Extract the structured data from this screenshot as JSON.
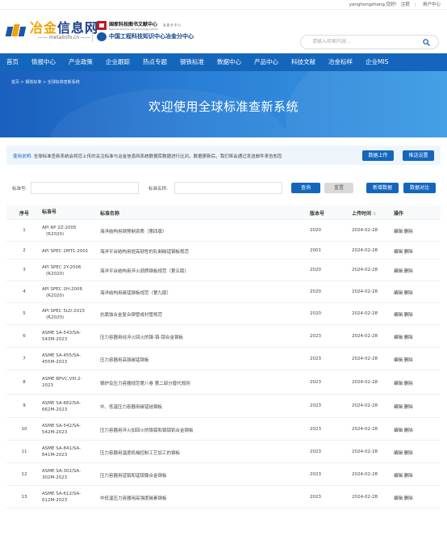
{
  "topbar": {
    "user": "yanghongzhang,您好!",
    "logout": "注销",
    "user_center": "用户中心"
  },
  "logo": {
    "cn_part1": "冶金",
    "cn_part2": "信息网",
    "url": "metalinfo.cn"
  },
  "partner": {
    "name1": "国家科技图书文献中心",
    "sub1": "National Science and Technology Library",
    "side1": "冶 金 分 中 心",
    "name2": "中国工程科技知识中心冶金分中心"
  },
  "search": {
    "placeholder": "请输入检索内容..."
  },
  "nav": [
    "首页",
    "情报中心",
    "产业政策",
    "企业跟踪",
    "热点专题",
    "钢铁标准",
    "数据中心",
    "产品中心",
    "科技文献",
    "冶金标样",
    "企业MIS"
  ],
  "banner": {
    "breadcrumb": "首页 > 钢铁标准 > 全球标准查新系统",
    "title": "欢迎使用全球标准查新系统"
  },
  "notice": {
    "label": "使用说明:",
    "text": "全球标准查新系统会将您上传的关注标准与冶金信息网系统数据库数据进行比对。数据更新后，我们将会通过发送邮件来告知您",
    "upload_btn": "数据上传",
    "push_btn": "推送设置"
  },
  "filter": {
    "std_no_label": "标准号:",
    "std_name_label": "标准名称:",
    "query_btn": "查询",
    "reset_btn": "重置",
    "add_btn": "新增数据",
    "compare_btn": "数据对比"
  },
  "table": {
    "headers": {
      "idx": "序号",
      "no": "标准号",
      "name": "标准名称",
      "ver": "版本号",
      "date": "上传时间",
      "op": "操作"
    },
    "edit": "编辑",
    "delete": "删除",
    "rows": [
      {
        "idx": "1",
        "no1": "API RP 2Z-2005",
        "no2": "(R2020)",
        "name": "海洋结构用钢预制资质（第四版）",
        "ver": "2020",
        "date": "2024-02-28"
      },
      {
        "idx": "2",
        "no1": "API SPEC 2MT1-2001",
        "no2": "",
        "name": "海洋平台结构用提高韧性的轧制碳锰钢板规范",
        "ver": "2001",
        "date": "2024-02-28"
      },
      {
        "idx": "3",
        "no1": "API SPEC 2Y-2006",
        "no2": "(R2020)",
        "name": "海洋平台结构用淬火调质钢板规范（第五版）",
        "ver": "2020",
        "date": "2024-02-28"
      },
      {
        "idx": "4",
        "no1": "API SPEC 2H-2006",
        "no2": "(R2020)",
        "name": "海洋结构用碳锰钢板规范（第九版）",
        "ver": "2020",
        "date": "2024-02-28"
      },
      {
        "idx": "5",
        "no1": "API SPEC 5LD-2015",
        "no2": "(R2020)",
        "name": "抗腐蚀合金复合钢管或衬管规范",
        "ver": "2020",
        "date": "2024-02-28"
      },
      {
        "idx": "6",
        "no1": "ASME SA-543/SA-",
        "no2": "543M-2023",
        "name": "压力容器用经淬火回火的镍-铬-钼合金钢板",
        "ver": "2023",
        "date": "2024-02-28"
      },
      {
        "idx": "7",
        "no1": "ASME SA-455/SA-",
        "no2": "455M-2023",
        "name": "压力容器用高强碳锰钢板",
        "ver": "2023",
        "date": "2024-02-28"
      },
      {
        "idx": "8",
        "no1": "ASME BPVC.VIII.2-",
        "no2": "2023",
        "name": "锅炉及压力容器规范第八卷 第二部分替代规则",
        "ver": "2023",
        "date": "2024-02-28"
      },
      {
        "idx": "9",
        "no1": "ASME SA-662/SA-",
        "no2": "662M-2023",
        "name": "中、低温压力容器用碳锰硅钢板",
        "ver": "2023",
        "date": "2024-02-28"
      },
      {
        "idx": "10",
        "no1": "ASME SA-542/SA-",
        "no2": "542M-2023",
        "name": "压力容器用淬火加回火的铬钼和铬钼钒合金钢板",
        "ver": "2023",
        "date": "2024-02-28"
      },
      {
        "idx": "11",
        "no1": "ASME SA-841/SA-",
        "no2": "841M-2023",
        "name": "压力容器用温度机械控制工艺加工的钢板",
        "ver": "2023",
        "date": "2024-02-28"
      },
      {
        "idx": "12",
        "no1": "ASME SA-302/SA-",
        "no2": "302M-2023",
        "name": "压力容器用锰钼和锰钼镍合金钢板",
        "ver": "2023",
        "date": "2024-02-28"
      },
      {
        "idx": "13",
        "no1": "ASME SA-612/SA-",
        "no2": "612M-2023",
        "name": "中低温压力容器用高强度碳素钢板",
        "ver": "2023",
        "date": "2024-02-28"
      }
    ]
  },
  "colors": {
    "primary": "#1466bd",
    "gold": "#f0a300",
    "logo_blue": "#1a3f8f"
  }
}
